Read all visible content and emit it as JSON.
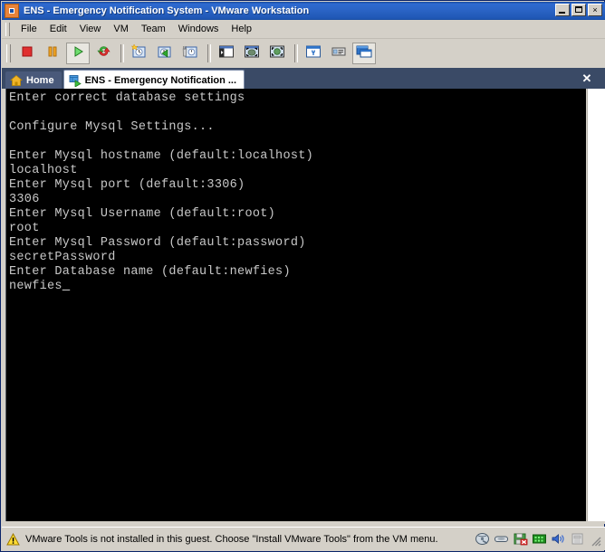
{
  "window": {
    "title": "ENS - Emergency Notification System - VMware Workstation",
    "icon": "vmware-app-icon",
    "buttons": {
      "minimize": "minimize-button",
      "maximize": "maximize-button",
      "close_label": "×"
    }
  },
  "menu": {
    "items": [
      {
        "label": "File"
      },
      {
        "label": "Edit"
      },
      {
        "label": "View"
      },
      {
        "label": "VM"
      },
      {
        "label": "Team"
      },
      {
        "label": "Windows"
      },
      {
        "label": "Help"
      }
    ]
  },
  "toolbar": {
    "groups": [
      {
        "buttons": [
          {
            "name": "power-off-button",
            "icon": "stop-square-icon",
            "selected": false
          },
          {
            "name": "suspend-button",
            "icon": "pause-bars-icon",
            "selected": false
          },
          {
            "name": "power-on-button",
            "icon": "play-triangle-icon",
            "selected": true
          },
          {
            "name": "reset-button",
            "icon": "reset-arrows-icon",
            "selected": false
          }
        ]
      },
      {
        "buttons": [
          {
            "name": "take-snapshot-button",
            "icon": "snapshot-new-icon",
            "selected": false
          },
          {
            "name": "revert-snapshot-button",
            "icon": "snapshot-revert-icon",
            "selected": false
          },
          {
            "name": "snapshot-manager-button",
            "icon": "snapshot-manager-icon",
            "selected": false
          }
        ]
      },
      {
        "buttons": [
          {
            "name": "show-sidebar-button",
            "icon": "sidebar-panel-icon",
            "selected": false
          },
          {
            "name": "quick-switch-button",
            "icon": "quick-switch-icon",
            "selected": false
          },
          {
            "name": "fullscreen-button",
            "icon": "fullscreen-icon",
            "selected": false
          }
        ]
      },
      {
        "buttons": [
          {
            "name": "vm-settings-button",
            "icon": "wrench-settings-icon",
            "selected": false
          },
          {
            "name": "summary-view-button",
            "icon": "summary-card-icon",
            "selected": false
          },
          {
            "name": "console-view-button",
            "icon": "console-window-icon",
            "selected": true
          }
        ]
      }
    ]
  },
  "tabs": [
    {
      "label": "Home",
      "icon": "home-icon",
      "active": false
    },
    {
      "label": "ENS - Emergency Notification ...",
      "icon": "vm-tab-icon",
      "active": true
    }
  ],
  "tab_close_label": "✕",
  "console": {
    "lines": [
      "Enter correct database settings",
      "",
      "Configure Mysql Settings...",
      "",
      "Enter Mysql hostname (default:localhost)",
      "localhost",
      "Enter Mysql port (default:3306)",
      "3306",
      "Enter Mysql Username (default:root)",
      "root",
      "Enter Mysql Password (default:password)",
      "secretPassword",
      "Enter Database name (default:newfies)",
      "newfies"
    ],
    "cursor": "_",
    "foreground": "#c8c8c8",
    "background": "#000000"
  },
  "status_bar": {
    "warning_icon": "warning-triangle-icon",
    "message": "VMware Tools is not installed in this guest. Choose \"Install VMware Tools\" from the VM menu.",
    "icons": [
      {
        "name": "status-disk-icon",
        "title": "hard-disk"
      },
      {
        "name": "status-cd-icon",
        "title": "cd-drive"
      },
      {
        "name": "status-floppy-icon",
        "title": "floppy-drive"
      },
      {
        "name": "status-network-icon",
        "title": "network-adapter"
      },
      {
        "name": "status-sound-icon",
        "title": "sound-adapter"
      },
      {
        "name": "status-usb-icon",
        "title": "usb-device"
      }
    ],
    "resize_grip": "resize-grip"
  }
}
